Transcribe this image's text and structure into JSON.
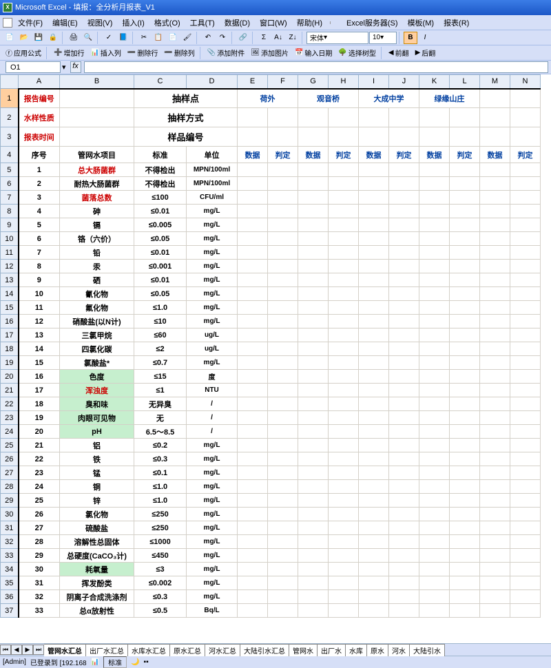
{
  "title": "Microsoft Excel - 填报：全分析月报表_V1",
  "menus": [
    "文件(F)",
    "编辑(E)",
    "视图(V)",
    "插入(I)",
    "格式(O)",
    "工具(T)",
    "数据(D)",
    "窗口(W)",
    "帮助(H)",
    "Excel服务器(S)",
    "模板(M)",
    "报表(R)"
  ],
  "font_name": "宋体",
  "font_size": "10",
  "toolbar3": [
    "应用公式",
    "增加行",
    "插入列",
    "删除行",
    "删除列",
    "添加附件",
    "添加图片",
    "输入日期",
    "选择树型",
    "前翻",
    "后翻"
  ],
  "name_box": "O1",
  "header_cols": [
    "",
    "A",
    "B",
    "C",
    "D",
    "E",
    "F",
    "G",
    "H",
    "I",
    "J",
    "K",
    "L",
    "M",
    "N"
  ],
  "row1": {
    "a": "报告编号",
    "c": "抽样点",
    "ef": "荷外",
    "gh": "观音桥",
    "ij": "大成中学",
    "kl": "绿缘山庄"
  },
  "row2": {
    "a": "水样性质",
    "c": "抽样方式"
  },
  "row3": {
    "a": "报表时间",
    "c": "样品编号"
  },
  "row4": {
    "a": "序号",
    "b": "管网水项目",
    "c": "标准",
    "d": "单位",
    "e": "数据",
    "f": "判定",
    "g": "数据",
    "h": "判定",
    "i": "数据",
    "j": "判定",
    "k": "数据",
    "l": "判定",
    "m": "数据",
    "n": "判定"
  },
  "rows": [
    {
      "rn": "5",
      "no": "1",
      "item": "总大肠菌群",
      "std": "不得检出",
      "unit": "MPN/100ml",
      "red": true
    },
    {
      "rn": "6",
      "no": "2",
      "item": "耐热大肠菌群",
      "std": "不得检出",
      "unit": "MPN/100ml"
    },
    {
      "rn": "7",
      "no": "3",
      "item": "菌落总数",
      "std": "≤100",
      "unit": "CFU/ml",
      "red": true
    },
    {
      "rn": "8",
      "no": "4",
      "item": "砷",
      "std": "≤0.01",
      "unit": "mg/L"
    },
    {
      "rn": "9",
      "no": "5",
      "item": "镉",
      "std": "≤0.005",
      "unit": "mg/L"
    },
    {
      "rn": "10",
      "no": "6",
      "item": "铬（六价）",
      "std": "≤0.05",
      "unit": "mg/L"
    },
    {
      "rn": "11",
      "no": "7",
      "item": "铅",
      "std": "≤0.01",
      "unit": "mg/L"
    },
    {
      "rn": "12",
      "no": "8",
      "item": "汞",
      "std": "≤0.001",
      "unit": "mg/L"
    },
    {
      "rn": "13",
      "no": "9",
      "item": "硒",
      "std": "≤0.01",
      "unit": "mg/L"
    },
    {
      "rn": "14",
      "no": "10",
      "item": "氰化物",
      "std": "≤0.05",
      "unit": "mg/L"
    },
    {
      "rn": "15",
      "no": "11",
      "item": "氟化物",
      "std": "≤1.0",
      "unit": "mg/L"
    },
    {
      "rn": "16",
      "no": "12",
      "item": "硝酸盐(以N计)",
      "std": "≤10",
      "unit": "mg/L"
    },
    {
      "rn": "17",
      "no": "13",
      "item": "三氯甲烷",
      "std": "≤60",
      "unit": "ug/L"
    },
    {
      "rn": "18",
      "no": "14",
      "item": "四氯化碳",
      "std": "≤2",
      "unit": "ug/L"
    },
    {
      "rn": "19",
      "no": "15",
      "item": "氯酸盐*",
      "std": "≤0.7",
      "unit": "mg/L"
    },
    {
      "rn": "20",
      "no": "16",
      "item": "色度",
      "std": "≤15",
      "unit": "度",
      "green": true
    },
    {
      "rn": "21",
      "no": "17",
      "item": "浑浊度",
      "std": "≤1",
      "unit": "NTU",
      "red": true,
      "green": true
    },
    {
      "rn": "22",
      "no": "18",
      "item": "臭和味",
      "std": "无异臭",
      "unit": "/",
      "green": true
    },
    {
      "rn": "23",
      "no": "19",
      "item": "肉眼可见物",
      "std": "无",
      "unit": "/",
      "green": true
    },
    {
      "rn": "24",
      "no": "20",
      "item": "pH",
      "std": "6.5～8.5",
      "unit": "/",
      "green": true
    },
    {
      "rn": "25",
      "no": "21",
      "item": "铝",
      "std": "≤0.2",
      "unit": "mg/L"
    },
    {
      "rn": "26",
      "no": "22",
      "item": "铁",
      "std": "≤0.3",
      "unit": "mg/L"
    },
    {
      "rn": "27",
      "no": "23",
      "item": "锰",
      "std": "≤0.1",
      "unit": "mg/L"
    },
    {
      "rn": "28",
      "no": "24",
      "item": "铜",
      "std": "≤1.0",
      "unit": "mg/L"
    },
    {
      "rn": "29",
      "no": "25",
      "item": "锌",
      "std": "≤1.0",
      "unit": "mg/L"
    },
    {
      "rn": "30",
      "no": "26",
      "item": "氯化物",
      "std": "≤250",
      "unit": "mg/L"
    },
    {
      "rn": "31",
      "no": "27",
      "item": "硫酸盐",
      "std": "≤250",
      "unit": "mg/L"
    },
    {
      "rn": "32",
      "no": "28",
      "item": "溶解性总固体",
      "std": "≤1000",
      "unit": "mg/L"
    },
    {
      "rn": "33",
      "no": "29",
      "item": "总硬度(CaCO₃计)",
      "std": "≤450",
      "unit": "mg/L"
    },
    {
      "rn": "34",
      "no": "30",
      "item": "耗氧量",
      "std": "≤3",
      "unit": "mg/L",
      "green": true
    },
    {
      "rn": "35",
      "no": "31",
      "item": "挥发酚类",
      "std": "≤0.002",
      "unit": "mg/L"
    },
    {
      "rn": "36",
      "no": "32",
      "item": "阴离子合成洗涤剂",
      "std": "≤0.3",
      "unit": "mg/L"
    },
    {
      "rn": "37",
      "no": "33",
      "item": "总α放射性",
      "std": "≤0.5",
      "unit": "Bq/L"
    }
  ],
  "tabs": [
    "管网水汇总",
    "出厂水汇总",
    "水库水汇总",
    "原水汇总",
    "河水汇总",
    "大陆引水汇总",
    "管网水",
    "出厂水",
    "水库",
    "原水",
    "河水",
    "大陆引水"
  ],
  "status_user": "[Admin]",
  "status_login": "已登录到 [192.168",
  "status_mode": "标准"
}
